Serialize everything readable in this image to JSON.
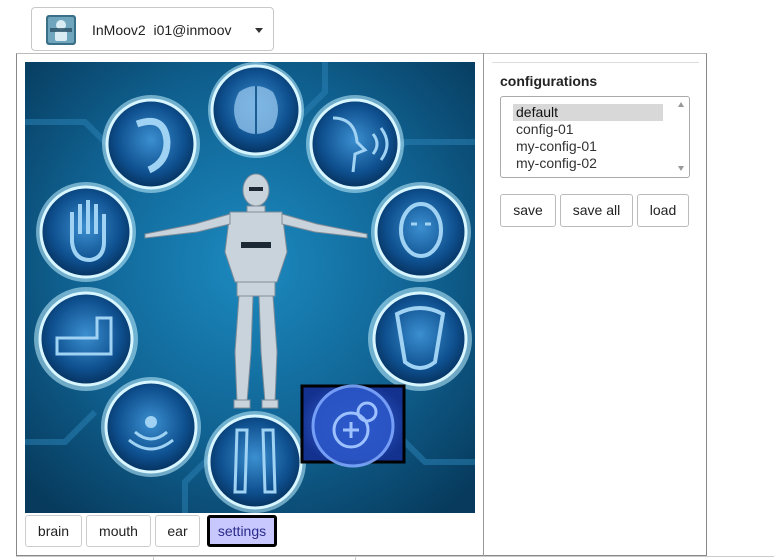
{
  "header": {
    "selector_label": "InMoov2  i01@inmoov",
    "logo_icon": "inmoov-logo-icon"
  },
  "tabs": [
    {
      "label": "brain"
    },
    {
      "label": "mouth"
    },
    {
      "label": "ear"
    },
    {
      "label": "settings",
      "active": true
    }
  ],
  "stage": {
    "icons": [
      "brain-icon",
      "ear-icon",
      "speech-icon",
      "hand-icon",
      "head-icon",
      "arm-icon",
      "torso-icon",
      "sensor-icon",
      "legs-icon",
      "settings-gear-icon"
    ],
    "colors": {
      "background": "#0f5a86",
      "glow": "#7ed8f8",
      "selected_border": "#000000"
    }
  },
  "configurations": {
    "title": "configurations",
    "options": [
      "default",
      "config-01",
      "my-config-01",
      "my-config-02"
    ],
    "selected": "default"
  },
  "buttons": {
    "save": "save",
    "save_all": "save all",
    "load": "load"
  }
}
